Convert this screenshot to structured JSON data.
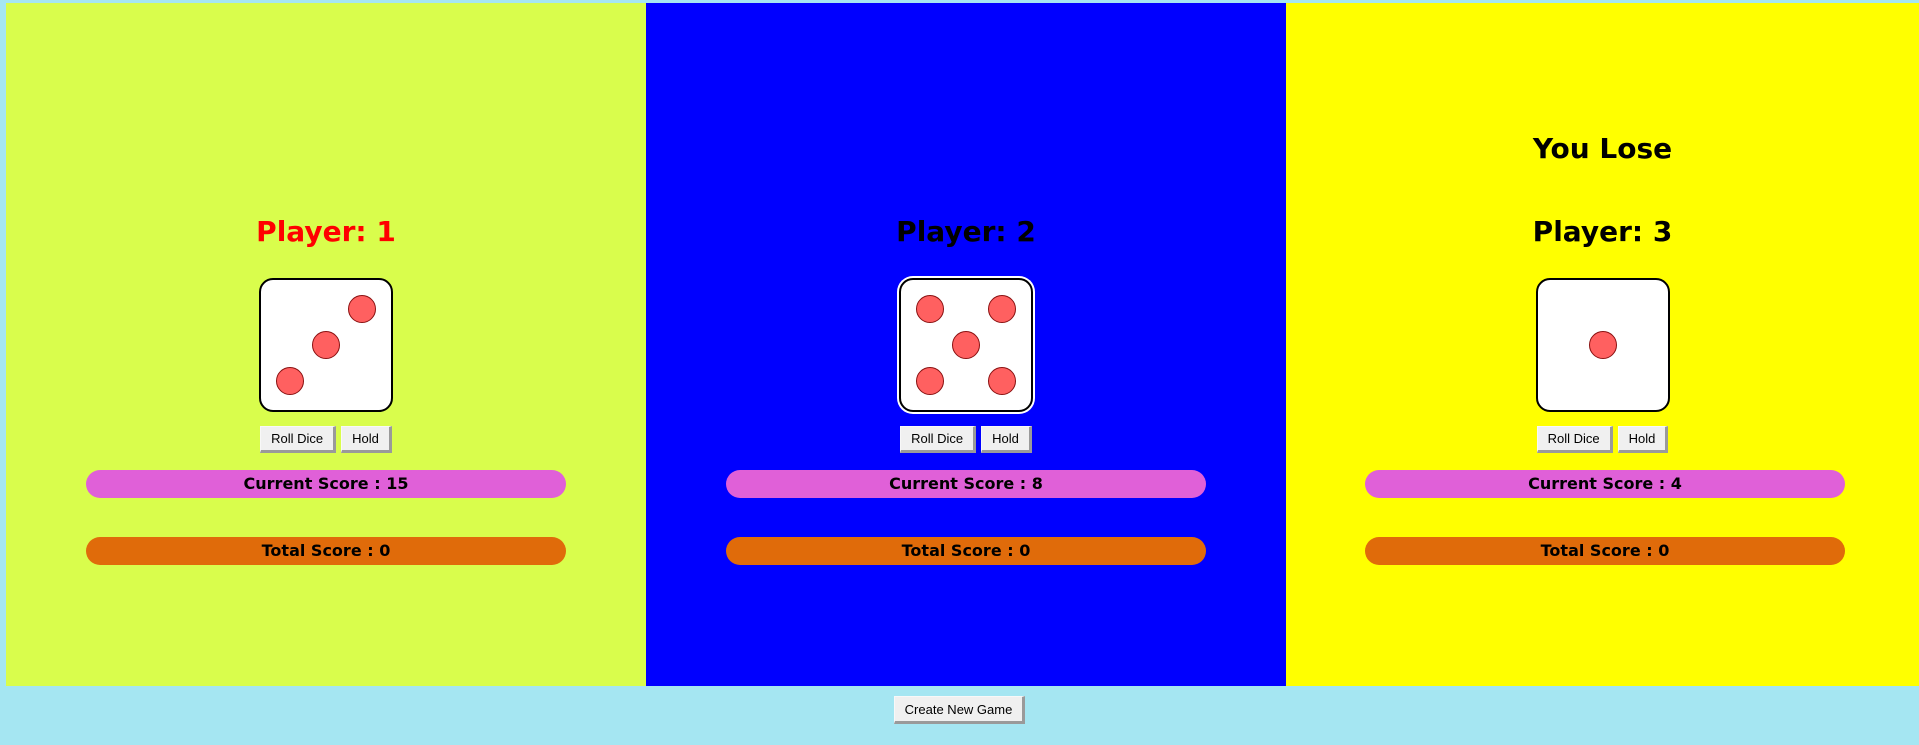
{
  "colors": {
    "page_background": "#a5e6f2",
    "current_score_bar": "#e060d8",
    "total_score_bar": "#e06b0a",
    "pip": "#ff6060",
    "active_player_name": "#ff0000"
  },
  "players": [
    {
      "name": "Player: 1",
      "status": "",
      "background": "#d9fd4c",
      "name_color": "#ff0000",
      "die_value": 3,
      "roll_label": "Roll Dice",
      "hold_label": "Hold",
      "current_score": "Current Score : 15",
      "total_score": "Total Score : 0"
    },
    {
      "name": "Player: 2",
      "status": "",
      "background": "#0000ff",
      "name_color": "#000000",
      "die_value": 5,
      "roll_label": "Roll Dice",
      "hold_label": "Hold",
      "current_score": "Current Score : 8",
      "total_score": "Total Score : 0"
    },
    {
      "name": "Player: 3",
      "status": "You Lose",
      "background": "#ffff00",
      "name_color": "#000000",
      "die_value": 1,
      "roll_label": "Roll Dice",
      "hold_label": "Hold",
      "current_score": "Current Score : 4",
      "total_score": "Total Score : 0"
    }
  ],
  "footer": {
    "new_game_label": "Create New Game"
  }
}
